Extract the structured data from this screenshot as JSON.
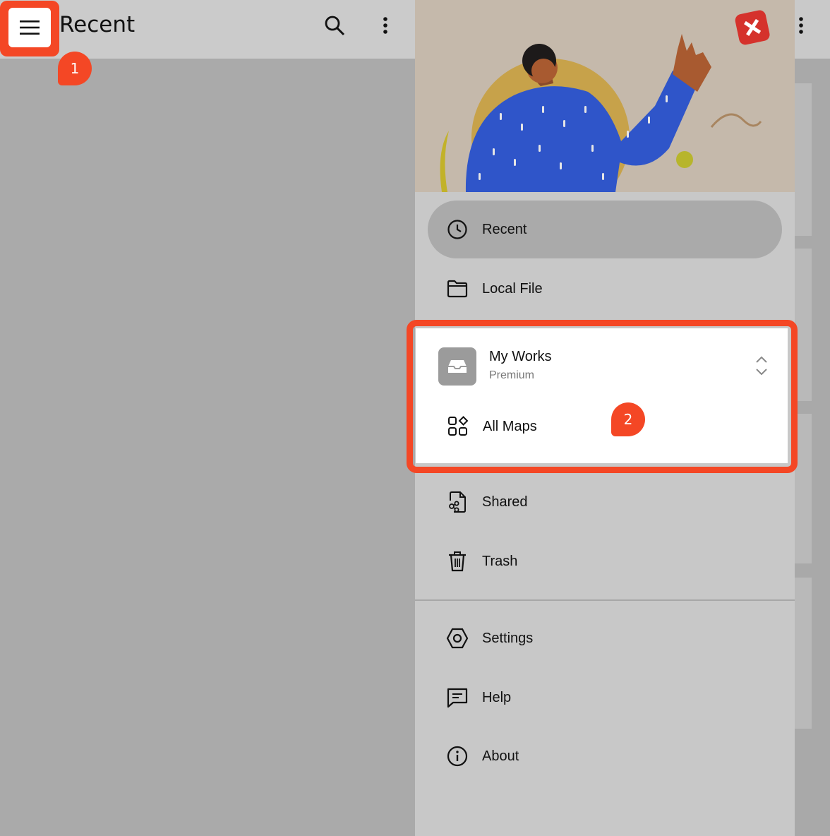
{
  "app": {
    "title": "Recent"
  },
  "annotations": {
    "step1": "1",
    "step2": "2"
  },
  "drawer": {
    "items_top": [
      {
        "label": "Recent",
        "icon": "clock-icon",
        "active": true
      },
      {
        "label": "Local File",
        "icon": "folder-icon",
        "active": false
      }
    ],
    "workspace": {
      "name": "My Works",
      "plan": "Premium",
      "icon": "inbox-tray-icon",
      "all_maps_label": "All Maps",
      "all_maps_icon": "grid-shapes-icon"
    },
    "items_middle": [
      {
        "label": "Shared",
        "icon": "shared-file-icon"
      },
      {
        "label": "Trash",
        "icon": "trash-icon"
      }
    ],
    "items_bottom": [
      {
        "label": "Settings",
        "icon": "settings-icon"
      },
      {
        "label": "Help",
        "icon": "help-chat-icon"
      },
      {
        "label": "About",
        "icon": "info-icon"
      }
    ]
  },
  "colors": {
    "annotation_accent": "#f44725",
    "drawer_bg": "#c8c8c8",
    "active_item_bg": "#aaaaaa",
    "scrim": "#aaaaaa"
  }
}
